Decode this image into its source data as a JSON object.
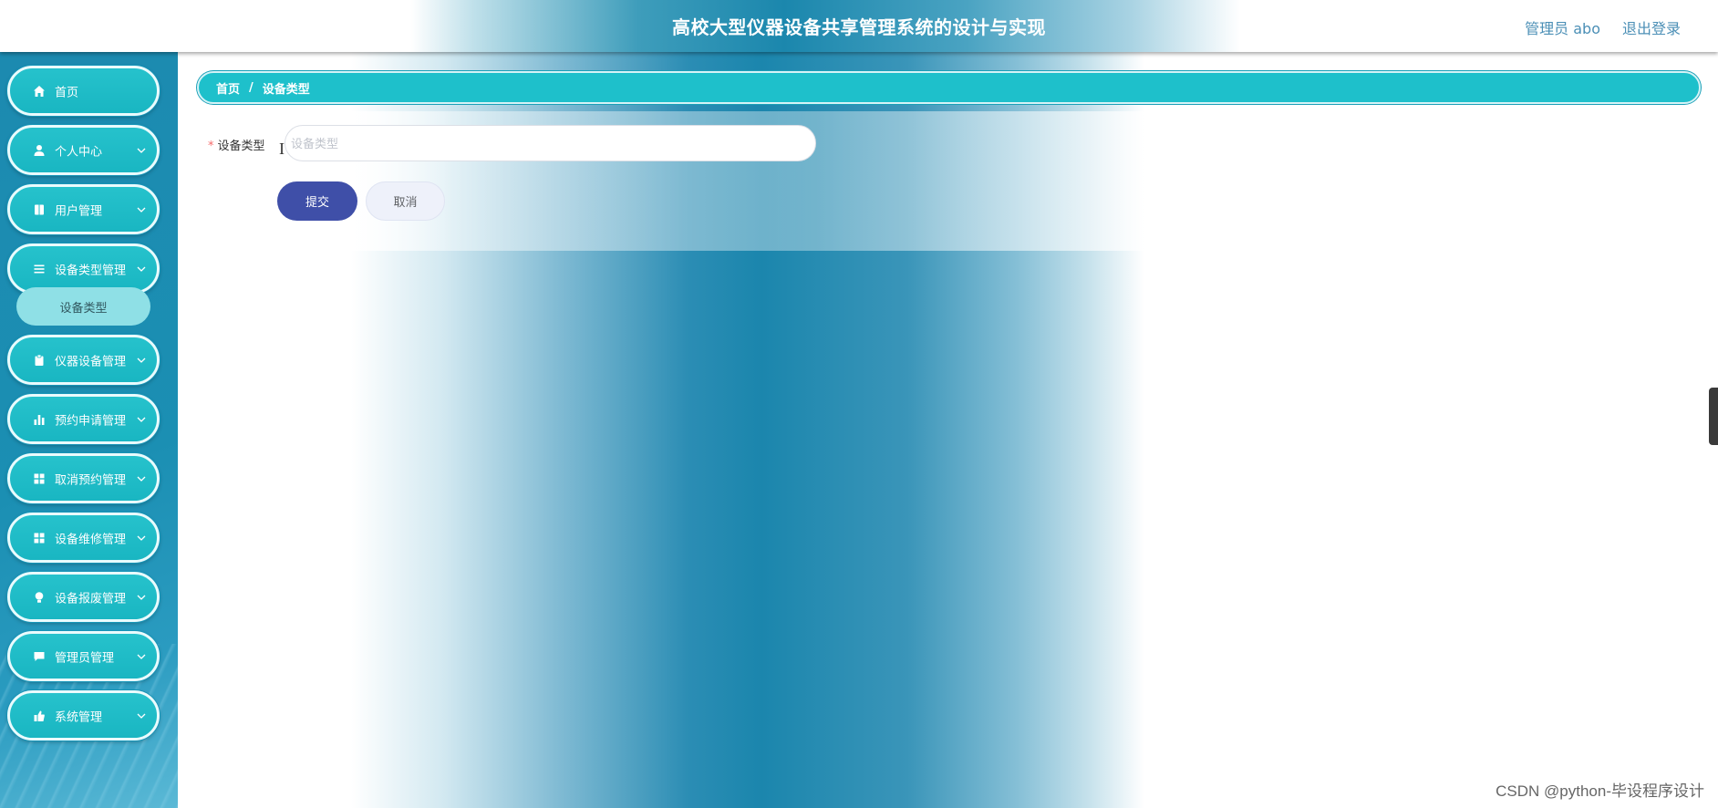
{
  "header": {
    "title": "高校大型仪器设备共享管理系统的设计与实现",
    "user_label": "管理员 abo",
    "logout_label": "退出登录"
  },
  "sidebar": {
    "items": [
      {
        "label": "首页",
        "icon": "home-icon",
        "has_arrow": false
      },
      {
        "label": "个人中心",
        "icon": "person-icon",
        "has_arrow": true
      },
      {
        "label": "用户管理",
        "icon": "book-icon",
        "has_arrow": true
      },
      {
        "label": "设备类型管理",
        "icon": "list-icon",
        "has_arrow": true
      },
      {
        "label": "仪器设备管理",
        "icon": "clipboard-icon",
        "has_arrow": true
      },
      {
        "label": "预约申请管理",
        "icon": "bar-chart-icon",
        "has_arrow": true
      },
      {
        "label": "取消预约管理",
        "icon": "grid-icon",
        "has_arrow": true
      },
      {
        "label": "设备维修管理",
        "icon": "grid-icon",
        "has_arrow": true
      },
      {
        "label": "设备报废管理",
        "icon": "lightbulb-icon",
        "has_arrow": true
      },
      {
        "label": "管理员管理",
        "icon": "chat-icon",
        "has_arrow": true
      },
      {
        "label": "系统管理",
        "icon": "thumbs-up-icon",
        "has_arrow": true
      }
    ],
    "submenu": {
      "label": "设备类型"
    }
  },
  "breadcrumb": {
    "home": "首页",
    "separator": "/",
    "current": "设备类型"
  },
  "form": {
    "required_mark": "*",
    "field_label": "设备类型",
    "field_placeholder": "设备类型",
    "field_value": "",
    "submit_label": "提交",
    "cancel_label": "取消"
  },
  "watermark": "CSDN @python-毕设程序设计",
  "colors": {
    "menu_bg": "#1ec0cb",
    "submit_bg": "#3f4fa8",
    "sidebar_bg": "#1c8ab0"
  }
}
